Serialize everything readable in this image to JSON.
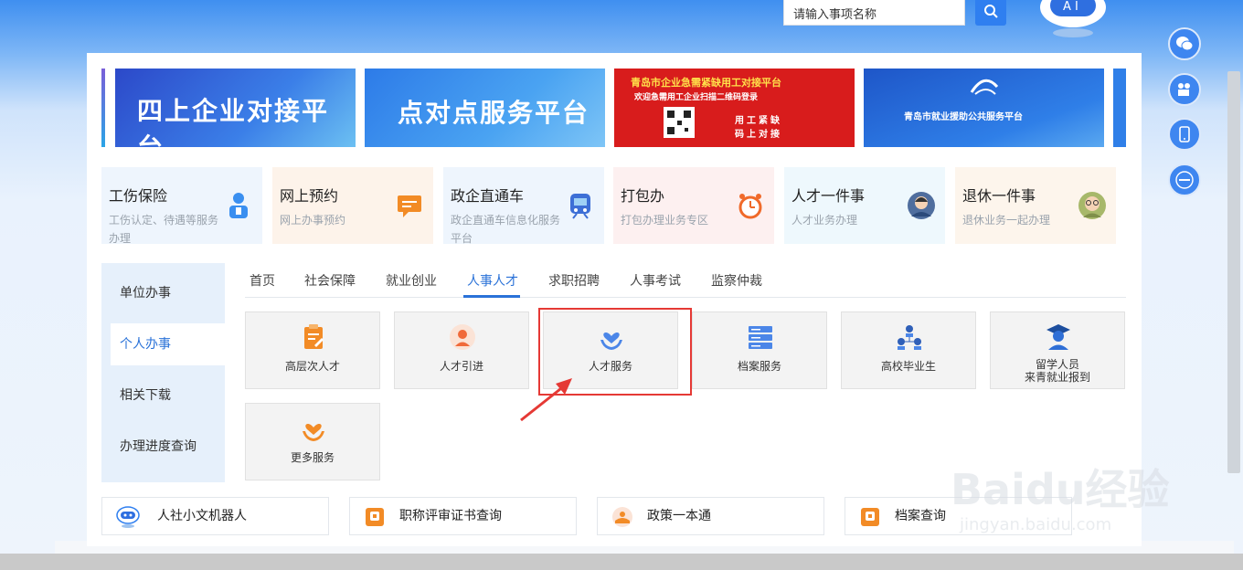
{
  "search": {
    "placeholder": "请输入事项名称"
  },
  "banners": [
    {
      "title": "四上企业对接平台"
    },
    {
      "title": "点对点服务平台"
    },
    {
      "title": "青岛市企业急需紧缺用工对接平台",
      "subtitle": "欢迎急需用工企业扫描二维码登录",
      "tagline1": "用工紧缺",
      "tagline2": "码上对接"
    },
    {
      "title": "青岛市就业援助公共服务平台"
    }
  ],
  "service_cards": [
    {
      "title": "工伤保险",
      "desc": "工伤认定、待遇等服务办理",
      "icon": "worker-icon"
    },
    {
      "title": "网上预约",
      "desc": "网上办事预约",
      "icon": "message-icon"
    },
    {
      "title": "政企直通车",
      "desc": "政企直通车信息化服务平台",
      "icon": "train-icon"
    },
    {
      "title": "打包办",
      "desc": "打包办理业务专区",
      "icon": "alarm-clock-icon"
    },
    {
      "title": "人才一件事",
      "desc": "人才业务办理",
      "icon": "person-avatar-icon"
    },
    {
      "title": "退休一件事",
      "desc": "退休业务一起办理",
      "icon": "elder-avatar-icon"
    }
  ],
  "left_menu": [
    {
      "label": "单位办事"
    },
    {
      "label": "个人办事",
      "active": true
    },
    {
      "label": "相关下载"
    },
    {
      "label": "办理进度查询"
    }
  ],
  "tabs": [
    {
      "label": "首页"
    },
    {
      "label": "社会保障"
    },
    {
      "label": "就业创业"
    },
    {
      "label": "人事人才",
      "active": true
    },
    {
      "label": "求职招聘"
    },
    {
      "label": "人事考试"
    },
    {
      "label": "监察仲裁"
    }
  ],
  "tiles": [
    {
      "label": "高层次人才",
      "icon": "clipboard-icon"
    },
    {
      "label": "人才引进",
      "icon": "person-badge-icon"
    },
    {
      "label": "人才服务",
      "icon": "heart-hands-icon",
      "highlighted": true
    },
    {
      "label": "档案服务",
      "icon": "server-stack-icon"
    },
    {
      "label": "高校毕业生",
      "icon": "people-network-icon"
    },
    {
      "label": "留学人员",
      "label2": "来青就业报到",
      "icon": "graduate-icon"
    },
    {
      "label": "更多服务",
      "icon": "heart-hands-icon"
    }
  ],
  "bottom_links": [
    {
      "label": "人社小文机器人",
      "icon": "robot-icon"
    },
    {
      "label": "职称评审证书查询",
      "icon": "certificate-icon"
    },
    {
      "label": "政策一本通",
      "icon": "policy-icon"
    },
    {
      "label": "档案查询",
      "icon": "archive-icon"
    }
  ],
  "watermark": {
    "brand": "Baidu经验",
    "url": "jingyan.baidu.com"
  },
  "colors": {
    "accent": "#2a72d8",
    "highlight": "#e53935",
    "icon_orange": "#f28b26",
    "icon_blue": "#2f7ff0"
  }
}
